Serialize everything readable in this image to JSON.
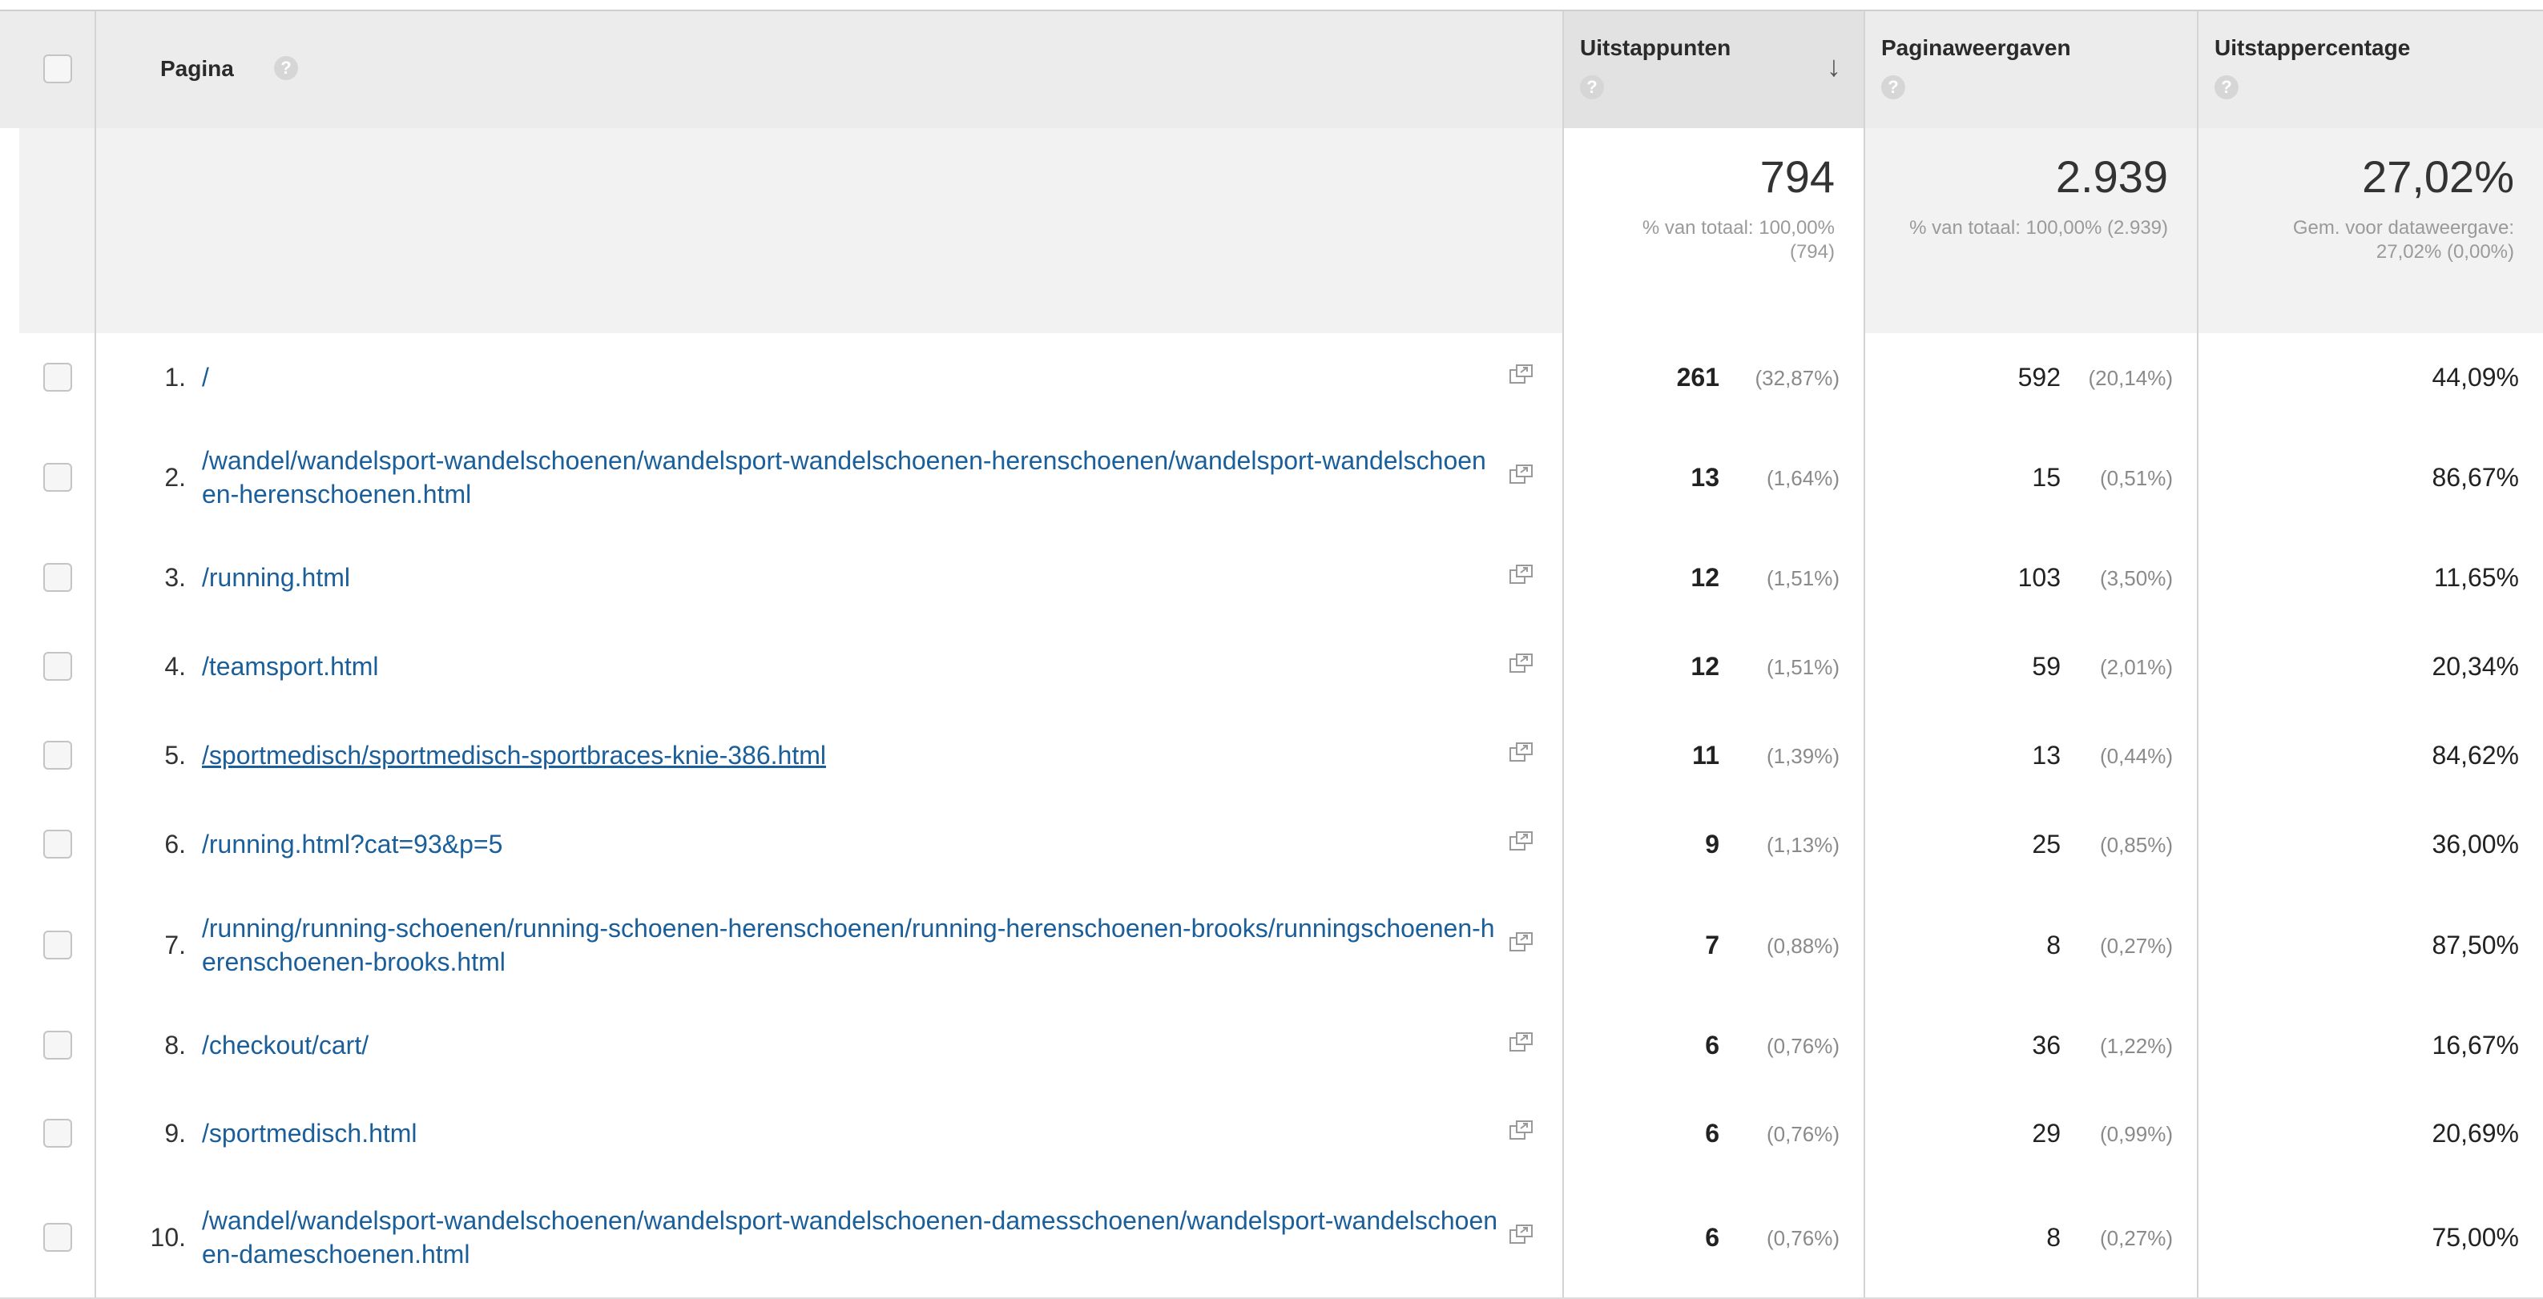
{
  "header": {
    "page": "Pagina",
    "exits": "Uitstappunten",
    "pageviews": "Paginaweergaven",
    "exit_rate": "Uitstappercentage",
    "help": "?"
  },
  "totals": {
    "exits": "794",
    "exits_sub": "% van totaal: 100,00% (794)",
    "pageviews": "2.939",
    "pageviews_sub": "% van totaal: 100,00% (2.939)",
    "exit_rate": "27,02%",
    "exit_rate_sub": "Gem. voor dataweergave: 27,02% (0,00%)"
  },
  "rows": [
    {
      "idx": "1.",
      "page": "/",
      "exits": "261",
      "exits_pct": "(32,87%)",
      "views": "592",
      "views_pct": "(20,14%)",
      "rate": "44,09%"
    },
    {
      "idx": "2.",
      "page": "/wandel/wandelsport-wandelschoenen/wandelsport-wandelschoenen-herenschoenen/wandelsport-wandelschoenen-herenschoenen.html",
      "exits": "13",
      "exits_pct": "(1,64%)",
      "views": "15",
      "views_pct": "(0,51%)",
      "rate": "86,67%"
    },
    {
      "idx": "3.",
      "page": "/running.html",
      "exits": "12",
      "exits_pct": "(1,51%)",
      "views": "103",
      "views_pct": "(3,50%)",
      "rate": "11,65%"
    },
    {
      "idx": "4.",
      "page": "/teamsport.html",
      "exits": "12",
      "exits_pct": "(1,51%)",
      "views": "59",
      "views_pct": "(2,01%)",
      "rate": "20,34%"
    },
    {
      "idx": "5.",
      "page": "/sportmedisch/sportmedisch-sportbraces-knie-386.html",
      "exits": "11",
      "exits_pct": "(1,39%)",
      "views": "13",
      "views_pct": "(0,44%)",
      "rate": "84,62%"
    },
    {
      "idx": "6.",
      "page": "/running.html?cat=93&p=5",
      "exits": "9",
      "exits_pct": "(1,13%)",
      "views": "25",
      "views_pct": "(0,85%)",
      "rate": "36,00%"
    },
    {
      "idx": "7.",
      "page": "/running/running-schoenen/running-schoenen-herenschoenen/running-herenschoenen-brooks/runningschoenen-herenschoenen-brooks.html",
      "exits": "7",
      "exits_pct": "(0,88%)",
      "views": "8",
      "views_pct": "(0,27%)",
      "rate": "87,50%"
    },
    {
      "idx": "8.",
      "page": "/checkout/cart/",
      "exits": "6",
      "exits_pct": "(0,76%)",
      "views": "36",
      "views_pct": "(1,22%)",
      "rate": "16,67%"
    },
    {
      "idx": "9.",
      "page": "/sportmedisch.html",
      "exits": "6",
      "exits_pct": "(0,76%)",
      "views": "29",
      "views_pct": "(0,99%)",
      "rate": "20,69%"
    },
    {
      "idx": "10.",
      "page": "/wandel/wandelsport-wandelschoenen/wandelsport-wandelschoenen-damesschoenen/wandelsport-wandelschoenen-dameschoenen.html",
      "exits": "6",
      "exits_pct": "(0,76%)",
      "views": "8",
      "views_pct": "(0,27%)",
      "rate": "75,00%"
    }
  ],
  "icons": {
    "help": "help-icon",
    "sort": "sort-down-arrow-icon",
    "external": "open-in-new-window-icon",
    "checkbox": "checkbox-icon"
  }
}
